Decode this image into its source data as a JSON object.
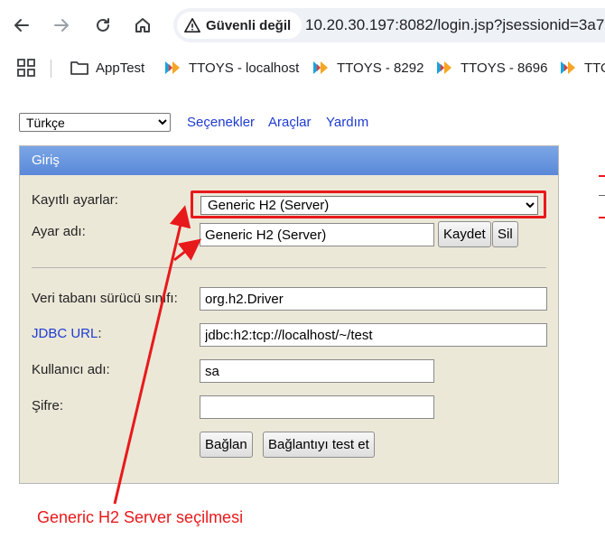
{
  "browser": {
    "security_label": "Güvenli değil",
    "url": "10.20.30.197:8082/login.jsp?jsessionid=3a7"
  },
  "bookmarks": [
    {
      "label": "AppTest",
      "icon": "folder-icon"
    },
    {
      "label": "TTOYS - localhost",
      "icon": "ttoys-icon"
    },
    {
      "label": "TTOYS - 8292",
      "icon": "ttoys-icon"
    },
    {
      "label": "TTOYS - 8696",
      "icon": "ttoys-icon"
    },
    {
      "label": "TTO",
      "icon": "ttoys-icon"
    }
  ],
  "top_menu": {
    "language": "Türkçe",
    "links": [
      "Seçenekler",
      "Araçlar",
      "Yardım"
    ]
  },
  "login_panel": {
    "header": "Giriş",
    "saved_settings_label": "Kayıtlı ayarlar:",
    "saved_settings_value": "Generic H2 (Server)",
    "setting_name_label": "Ayar adı:",
    "setting_name_value": "Generic H2 (Server)",
    "save_button": "Kaydet",
    "delete_button": "Sil",
    "driver_label": "Veri tabanı sürücü sınıfı:",
    "driver_value": "org.h2.Driver",
    "jdbc_url_label": "JDBC URL",
    "jdbc_url_colon": ":",
    "jdbc_url_value": "jdbc:h2:tcp://localhost/~/test",
    "username_label": "Kullanıcı adı:",
    "username_value": "sa",
    "password_label": "Şifre:",
    "password_value": "",
    "connect_button": "Bağlan",
    "test_button": "Bağlantıyı test et"
  },
  "annotation": {
    "text": "Generic H2 Server seçilmesi",
    "color": "#e8191b"
  }
}
